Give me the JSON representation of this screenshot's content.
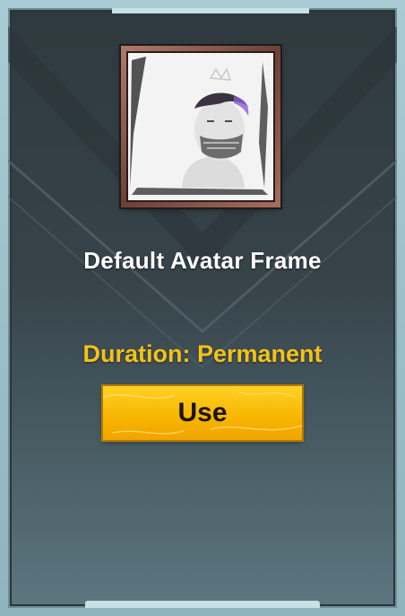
{
  "item": {
    "name": "Default Avatar Frame",
    "duration": "Duration: Permanent",
    "use_label": "Use"
  },
  "colors": {
    "panel": "#364349",
    "frame_outline": "#a9cbd4",
    "name_text": "#ffffff",
    "duration_text": "#f3c219",
    "button": "#f7b400"
  },
  "icons": {
    "avatar": "avatar-portrait-icon"
  }
}
